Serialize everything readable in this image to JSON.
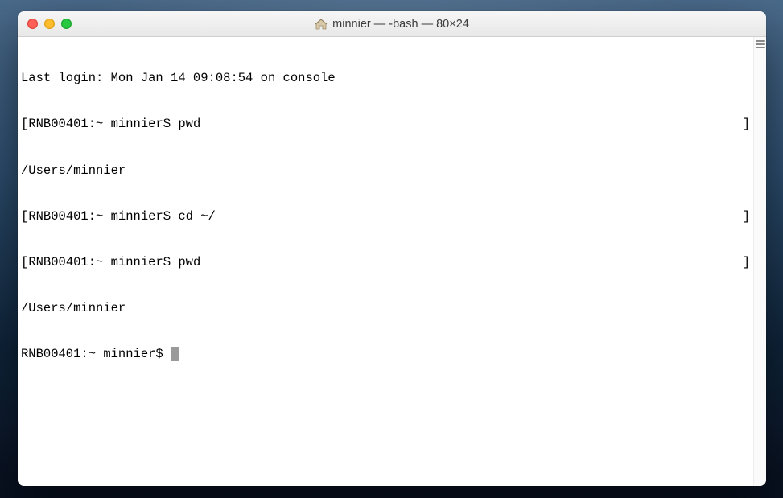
{
  "window": {
    "title": "minnier — -bash — 80×24"
  },
  "terminal": {
    "last_login": "Last login: Mon Jan 14 09:08:54 on console",
    "lines": [
      {
        "prompt": "RNB00401:~ minnier$ ",
        "cmd": "pwd"
      },
      {
        "output": "/Users/minnier"
      },
      {
        "prompt": "RNB00401:~ minnier$ ",
        "cmd": "cd ~/"
      },
      {
        "prompt": "RNB00401:~ minnier$ ",
        "cmd": "pwd"
      },
      {
        "output": "/Users/minnier"
      }
    ],
    "current_prompt": "RNB00401:~ minnier$ "
  }
}
